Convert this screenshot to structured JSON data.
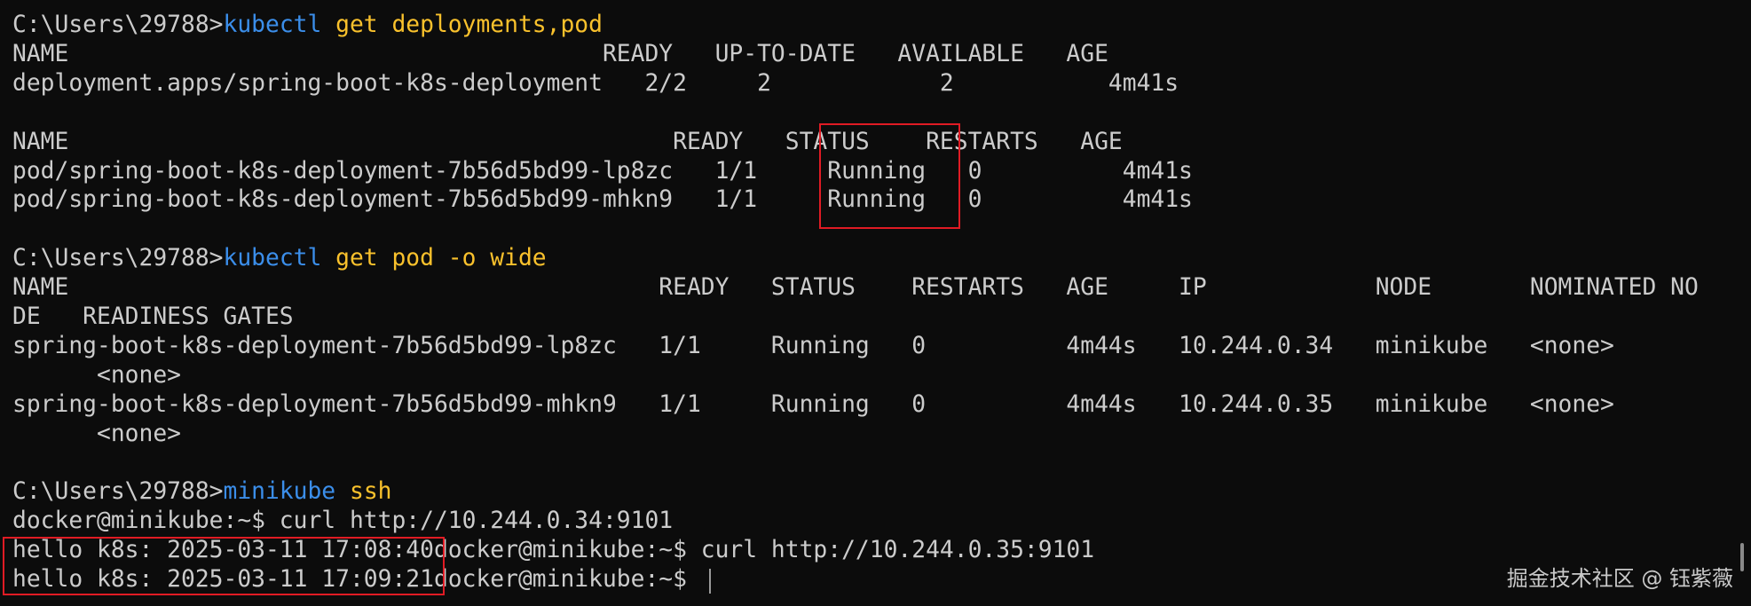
{
  "lines": [
    {
      "segments": [
        {
          "text": "C:\\Users\\29788>",
          "color": "default"
        },
        {
          "text": "kubectl",
          "color": "blue"
        },
        {
          "text": " get deployments,pod",
          "color": "yellow"
        }
      ]
    },
    {
      "segments": [
        {
          "text": "NAME                                      READY   UP-TO-DATE   AVAILABLE   AGE",
          "color": "default"
        }
      ]
    },
    {
      "segments": [
        {
          "text": "deployment.apps/spring-boot-k8s-deployment   2/2     2            2           4m41s",
          "color": "default"
        }
      ]
    },
    {
      "segments": [
        {
          "text": "",
          "color": "default"
        }
      ]
    },
    {
      "segments": [
        {
          "text": "NAME                                           READY   STATUS    RESTARTS   AGE",
          "color": "default"
        }
      ]
    },
    {
      "segments": [
        {
          "text": "pod/spring-boot-k8s-deployment-7b56d5bd99-lp8zc   1/1     Running   0          4m41s",
          "color": "default"
        }
      ]
    },
    {
      "segments": [
        {
          "text": "pod/spring-boot-k8s-deployment-7b56d5bd99-mhkn9   1/1     Running   0          4m41s",
          "color": "default"
        }
      ]
    },
    {
      "segments": [
        {
          "text": "",
          "color": "default"
        }
      ]
    },
    {
      "segments": [
        {
          "text": "C:\\Users\\29788>",
          "color": "default"
        },
        {
          "text": "kubectl",
          "color": "blue"
        },
        {
          "text": " get pod -o wide",
          "color": "yellow"
        }
      ]
    },
    {
      "segments": [
        {
          "text": "NAME                                          READY   STATUS    RESTARTS   AGE     IP            NODE       NOMINATED NO",
          "color": "default"
        }
      ]
    },
    {
      "segments": [
        {
          "text": "DE   READINESS GATES",
          "color": "default"
        }
      ]
    },
    {
      "segments": [
        {
          "text": "spring-boot-k8s-deployment-7b56d5bd99-lp8zc   1/1     Running   0          4m44s   10.244.0.34   minikube   <none>",
          "color": "default"
        }
      ]
    },
    {
      "segments": [
        {
          "text": "      <none>",
          "color": "default"
        }
      ]
    },
    {
      "segments": [
        {
          "text": "spring-boot-k8s-deployment-7b56d5bd99-mhkn9   1/1     Running   0          4m44s   10.244.0.35   minikube   <none>",
          "color": "default"
        }
      ]
    },
    {
      "segments": [
        {
          "text": "      <none>",
          "color": "default"
        }
      ]
    },
    {
      "segments": [
        {
          "text": "",
          "color": "default"
        }
      ]
    },
    {
      "segments": [
        {
          "text": "C:\\Users\\29788>",
          "color": "default"
        },
        {
          "text": "minikube",
          "color": "blue"
        },
        {
          "text": " ssh",
          "color": "yellow"
        }
      ]
    },
    {
      "segments": [
        {
          "text": "docker@minikube:~$ curl http://10.244.0.34:9101",
          "color": "default"
        }
      ]
    },
    {
      "segments": [
        {
          "text": "hello k8s: 2025-03-11 17:08:40docker@minikube:~$ curl http://10.244.0.35:9101",
          "color": "default"
        }
      ]
    },
    {
      "segments": [
        {
          "text": "hello k8s: 2025-03-11 17:09:21docker@minikube:~$ ",
          "color": "default"
        }
      ]
    }
  ],
  "watermark": "掘金技术社区 @ 钰紫薇"
}
